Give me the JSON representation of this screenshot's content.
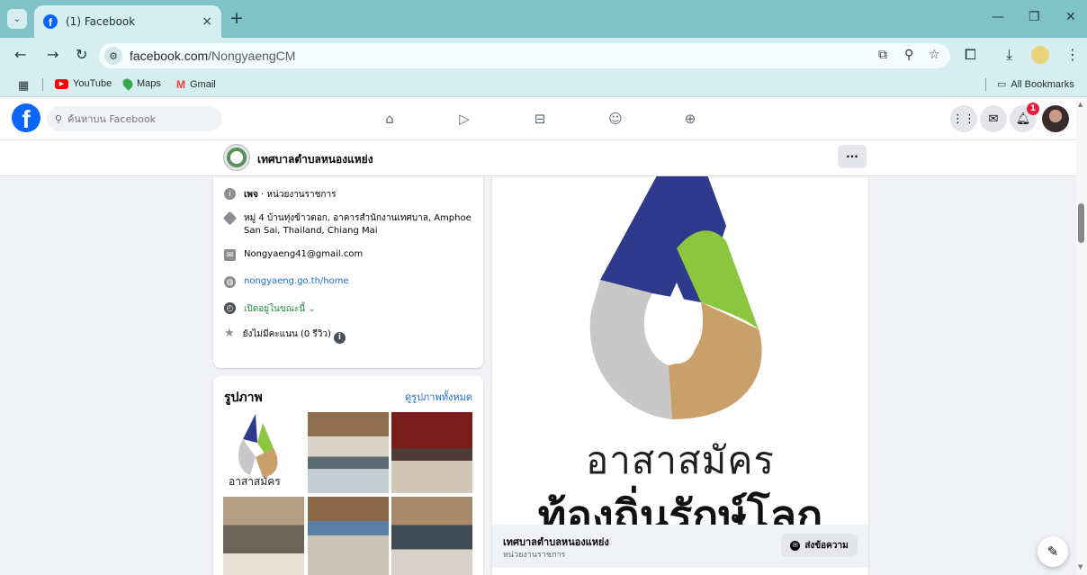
{
  "browser": {
    "tab_title": "(1) Facebook",
    "tab_close": "×",
    "new_tab": "+",
    "url_host": "facebook.com",
    "url_path": "/NongyaengCM",
    "bookmarks": [
      "YouTube",
      "Maps",
      "Gmail"
    ],
    "all_bookmarks": "All Bookmarks"
  },
  "facebook": {
    "search_placeholder": "ค้นหาบน Facebook",
    "notification_count": "1"
  },
  "page": {
    "name": "เทศบาลตำบลหนองแหย่ง",
    "more_label": "···"
  },
  "intro": {
    "type_bold": "เพจ",
    "type_rest": " · หน่วยงานราชการ",
    "address": "หมู่ 4 บ้านทุ่งข้าวตอก, อาคารสำนักงานเทศบาล, Amphoe San Sai, Thailand, Chiang Mai",
    "email": "Nongyaeng41@gmail.com",
    "website": "nongyaeng.go.th/home",
    "hours": "เปิดอยู่ในขณะนี้",
    "rating": "ยังไม่มีคะแนน (0 รีวิว)"
  },
  "photos": {
    "title": "รูปภาพ",
    "see_all": "ดูรูปภาพทั้งหมด",
    "logo_caption": "อาสาสมัคร"
  },
  "post": {
    "line1": "อาสาสมัคร",
    "line2": "ท้องถิ่นรักษ์โลก",
    "page_name": "เทศบาลตำบลหนองแหย่ง",
    "page_type": "หน่วยงานราชการ",
    "message_button": "ส่งข้อความ"
  },
  "colors": {
    "chrome_teal": "#7fc3c6",
    "facebook_blue": "#0866ff",
    "logo_navy": "#2e3a8c",
    "logo_green": "#8cc63f",
    "logo_gray": "#c8c8c8",
    "logo_tan": "#c9a06a"
  }
}
